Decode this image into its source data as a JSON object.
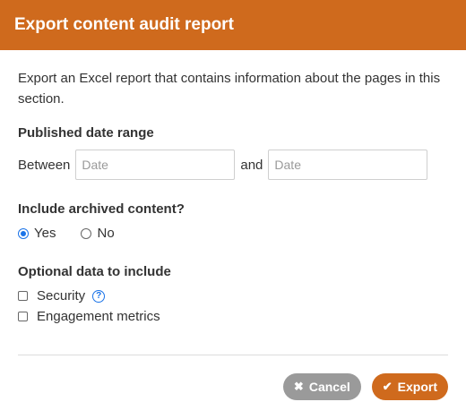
{
  "dialog": {
    "title": "Export content audit report",
    "description": "Export an Excel report that contains information about the pages in this section."
  },
  "date_range": {
    "title": "Published date range",
    "between_label": "Between",
    "and_label": "and",
    "from_placeholder": "Date",
    "to_placeholder": "Date"
  },
  "archived": {
    "title": "Include archived content?",
    "options": [
      {
        "label": "Yes",
        "selected": true
      },
      {
        "label": "No",
        "selected": false
      }
    ]
  },
  "optional": {
    "title": "Optional data to include",
    "items": [
      {
        "label": "Security",
        "checked": false,
        "has_help": true
      },
      {
        "label": "Engagement metrics",
        "checked": false,
        "has_help": false
      }
    ]
  },
  "buttons": {
    "cancel_label": "Cancel",
    "cancel_icon": "close-icon",
    "export_label": "Export",
    "export_icon": "check-icon"
  },
  "colors": {
    "header_bg": "#cf6a1d",
    "export_bg": "#cf6a1d",
    "cancel_bg": "#9a9a9a",
    "accent": "#1a73e8"
  }
}
